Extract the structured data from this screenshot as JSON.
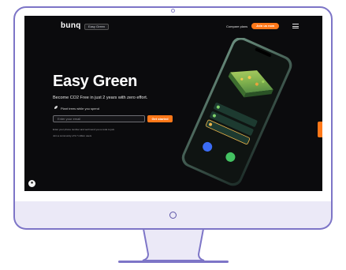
{
  "nav": {
    "logo": "bunq",
    "badge": "Easy Green",
    "link": "Compare plans",
    "cta": "Join us now"
  },
  "hero": {
    "title": "Easy Green",
    "subtitle": "Become CO2 Free in just 2 years with zero effort.",
    "feature": "Plant trees while you spend",
    "input_placeholder": "Enter your email",
    "submit": "Get started",
    "note_1": "Enter your phone number and we'll send you a code to join.",
    "note_2": "Join a community of 9.7 million users"
  },
  "colors": {
    "accent": "#ff7819",
    "monitor_outline": "#7d75c7",
    "screen_bg": "#0b0b0d"
  }
}
